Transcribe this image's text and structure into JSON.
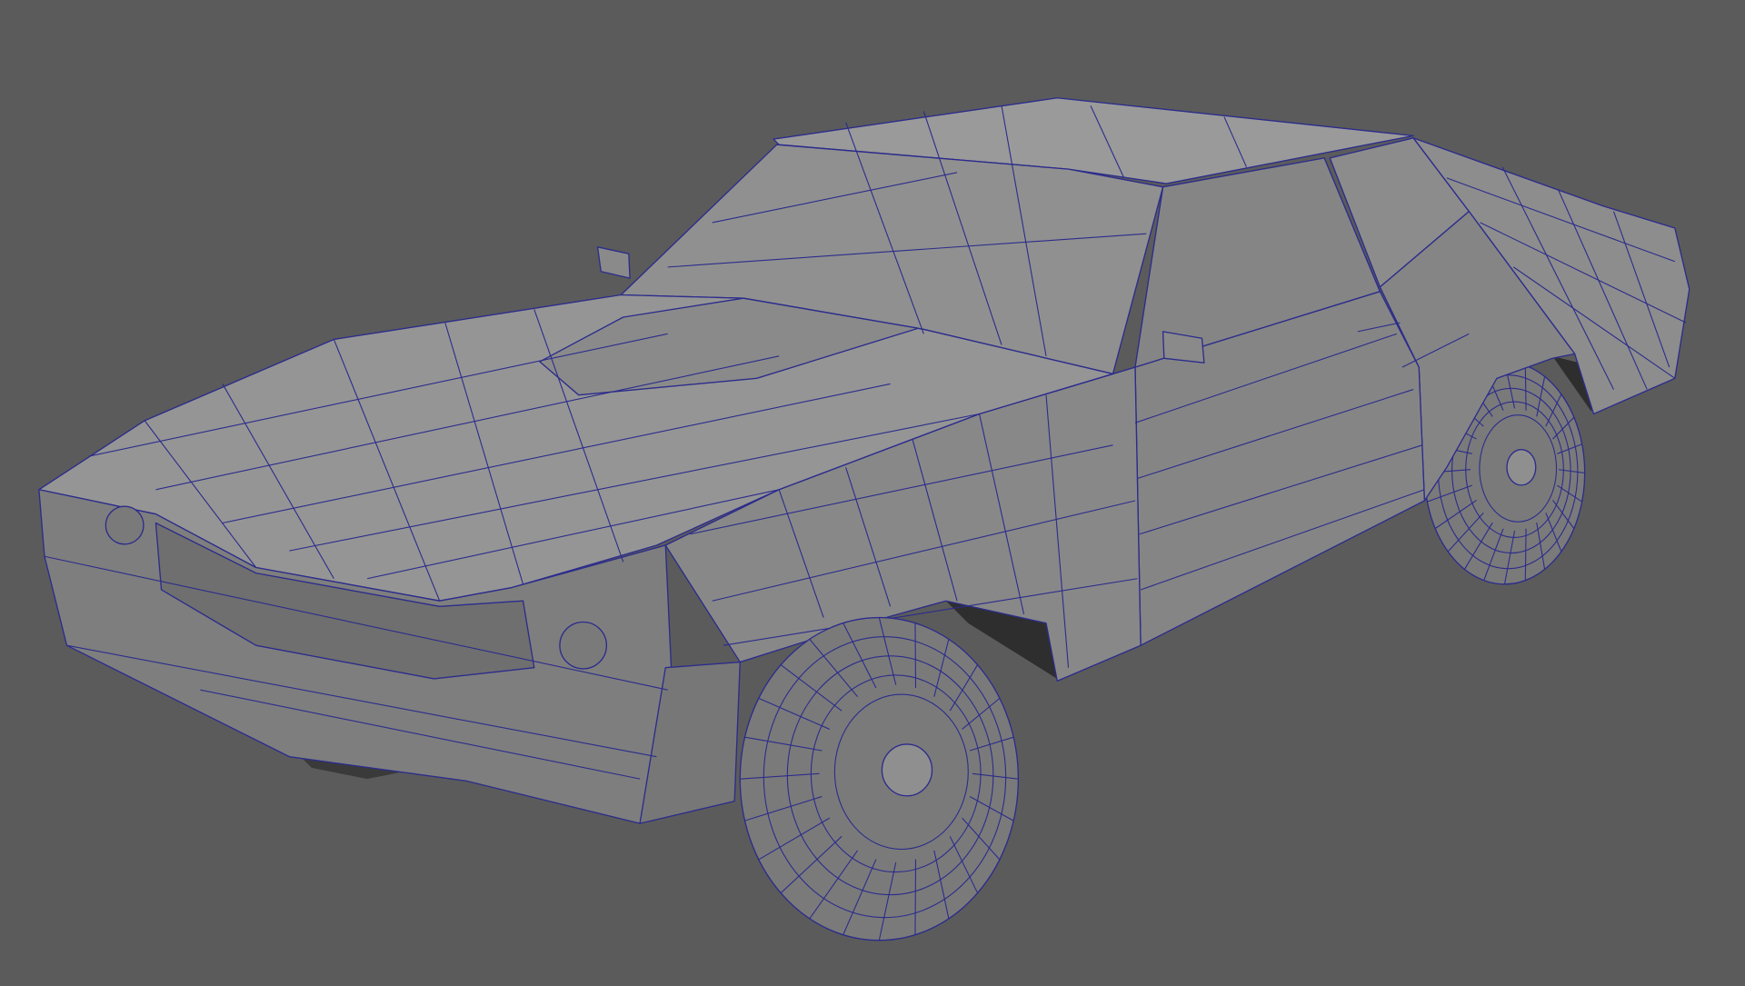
{
  "scene": {
    "subject": "car-wireframe-model",
    "colors": {
      "background": "#5b5b5b",
      "wire": "#2c2c8c",
      "body_light": "#9a9a9a",
      "body_mid": "#8a8a8a",
      "body_dark": "#6e6e6e",
      "glass": "#8f8f8f",
      "tire": "#7a7a7a",
      "shadow": "#3a3a3a"
    }
  }
}
